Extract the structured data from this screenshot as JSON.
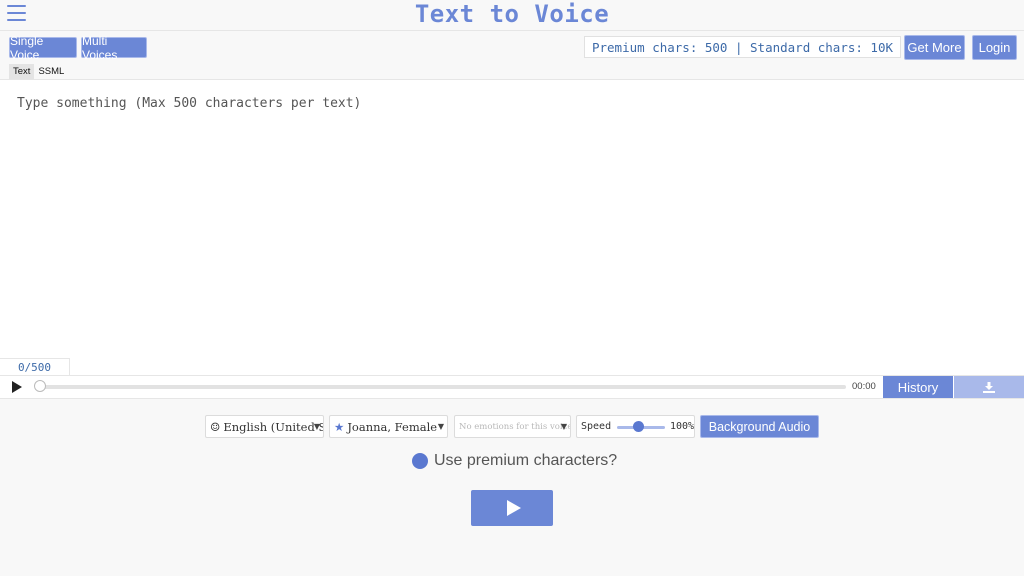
{
  "header": {
    "title": "Text to Voice",
    "menu_icon": "hamburger-icon"
  },
  "toolbar": {
    "single_voice_label": "Single Voice",
    "multi_voices_label": "Multi Voices",
    "chars_info": "Premium chars: 500 | Standard chars: 10K",
    "get_more_label": "Get More",
    "login_label": "Login"
  },
  "tabs": [
    {
      "label": "Text",
      "active": true
    },
    {
      "label": "SSML",
      "active": false
    }
  ],
  "editor": {
    "placeholder": "Type something (Max 500 characters per text)",
    "value": "",
    "counter": "0/500"
  },
  "player": {
    "play_icon": "play-icon",
    "time": "00:00",
    "history_label": "History",
    "download_icon": "download-icon"
  },
  "controls": {
    "language": "English (United States)",
    "voice": "Joanna, Female",
    "voice_icon": "star-icon",
    "language_icon": "smiley-icon",
    "emotion": "No emotions for this voice",
    "speed_label": "Speed",
    "speed_value": "100%",
    "background_audio_label": "Background Audio"
  },
  "premium": {
    "label": "Use premium characters?"
  },
  "colors": {
    "accent": "#6b87d6",
    "accent_light": "#a9b9ea",
    "chars_text": "#3d6aa8"
  }
}
